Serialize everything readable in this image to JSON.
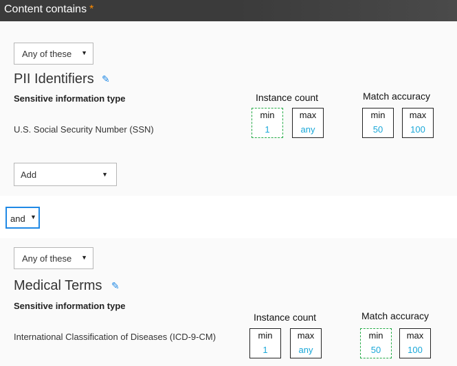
{
  "header": {
    "title": "Content contains",
    "required_mark": "*"
  },
  "operator": {
    "value": "and"
  },
  "groups": [
    {
      "match_mode": "Any of these",
      "name": "PII Identifiers",
      "column_header": "Sensitive information type",
      "instance_count_label": "Instance count",
      "match_accuracy_label": "Match accuracy",
      "rows": [
        {
          "type": "U.S. Social Security Number (SSN)",
          "instance_min_label": "min",
          "instance_min": "1",
          "instance_max_label": "max",
          "instance_max": "any",
          "accuracy_min_label": "min",
          "accuracy_min": "50",
          "accuracy_max_label": "max",
          "accuracy_max": "100"
        }
      ],
      "add_label": "Add"
    },
    {
      "match_mode": "Any of these",
      "name": "Medical Terms",
      "column_header": "Sensitive information type",
      "instance_count_label": "Instance count",
      "match_accuracy_label": "Match accuracy",
      "rows": [
        {
          "type": "International Classification of Diseases (ICD-9-CM)",
          "instance_min_label": "min",
          "instance_min": "1",
          "instance_max_label": "max",
          "instance_max": "any",
          "accuracy_min_label": "min",
          "accuracy_min": "50",
          "accuracy_max_label": "max",
          "accuracy_max": "100"
        }
      ]
    }
  ],
  "colors": {
    "header_bg": "#3b3b3b",
    "accent": "#1e88e5",
    "value_text": "#19a7d8",
    "selected_border": "#22aa44"
  }
}
